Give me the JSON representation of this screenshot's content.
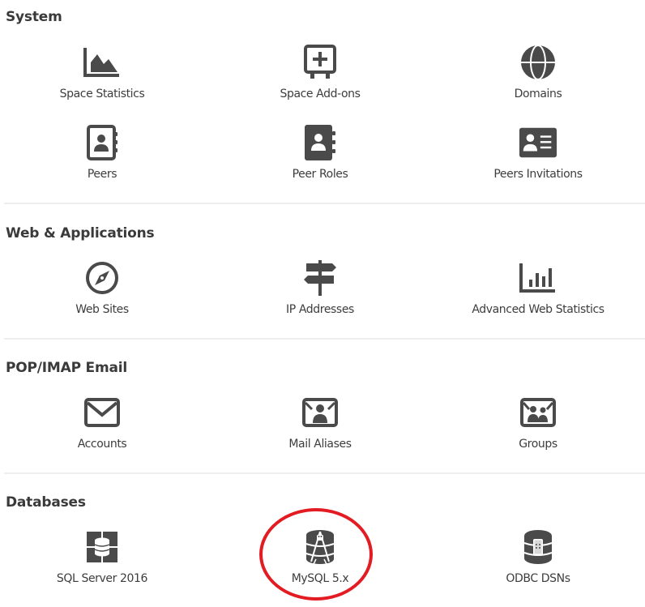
{
  "colors": {
    "icon": "#4a4a4a",
    "text": "#3d3d3d",
    "heading": "#3a3a3a",
    "divider": "#eeeeee",
    "highlight": "#e31b23"
  },
  "sections": [
    {
      "title": "System",
      "items": [
        {
          "label": "Space Statistics",
          "icon": "area-chart-icon"
        },
        {
          "label": "Space Add-ons",
          "icon": "add-board-icon"
        },
        {
          "label": "Domains",
          "icon": "globe-icon"
        },
        {
          "label": "Peers",
          "icon": "address-book-icon"
        },
        {
          "label": "Peer Roles",
          "icon": "contact-book-icon"
        },
        {
          "label": "Peers Invitations",
          "icon": "id-card-icon"
        }
      ]
    },
    {
      "title": "Web & Applications",
      "items": [
        {
          "label": "Web Sites",
          "icon": "compass-icon"
        },
        {
          "label": "IP Addresses",
          "icon": "signpost-icon"
        },
        {
          "label": "Advanced Web Statistics",
          "icon": "bar-chart-icon"
        }
      ]
    },
    {
      "title": "POP/IMAP Email",
      "items": [
        {
          "label": "Accounts",
          "icon": "envelope-icon"
        },
        {
          "label": "Mail Aliases",
          "icon": "mail-user-icon"
        },
        {
          "label": "Groups",
          "icon": "mail-group-icon"
        }
      ]
    },
    {
      "title": "Databases",
      "items": [
        {
          "label": "SQL Server 2016",
          "icon": "sql-server-icon"
        },
        {
          "label": "MySQL 5.x",
          "icon": "mysql-icon",
          "highlighted": true
        },
        {
          "label": "ODBC DSNs",
          "icon": "odbc-database-icon"
        }
      ]
    }
  ]
}
